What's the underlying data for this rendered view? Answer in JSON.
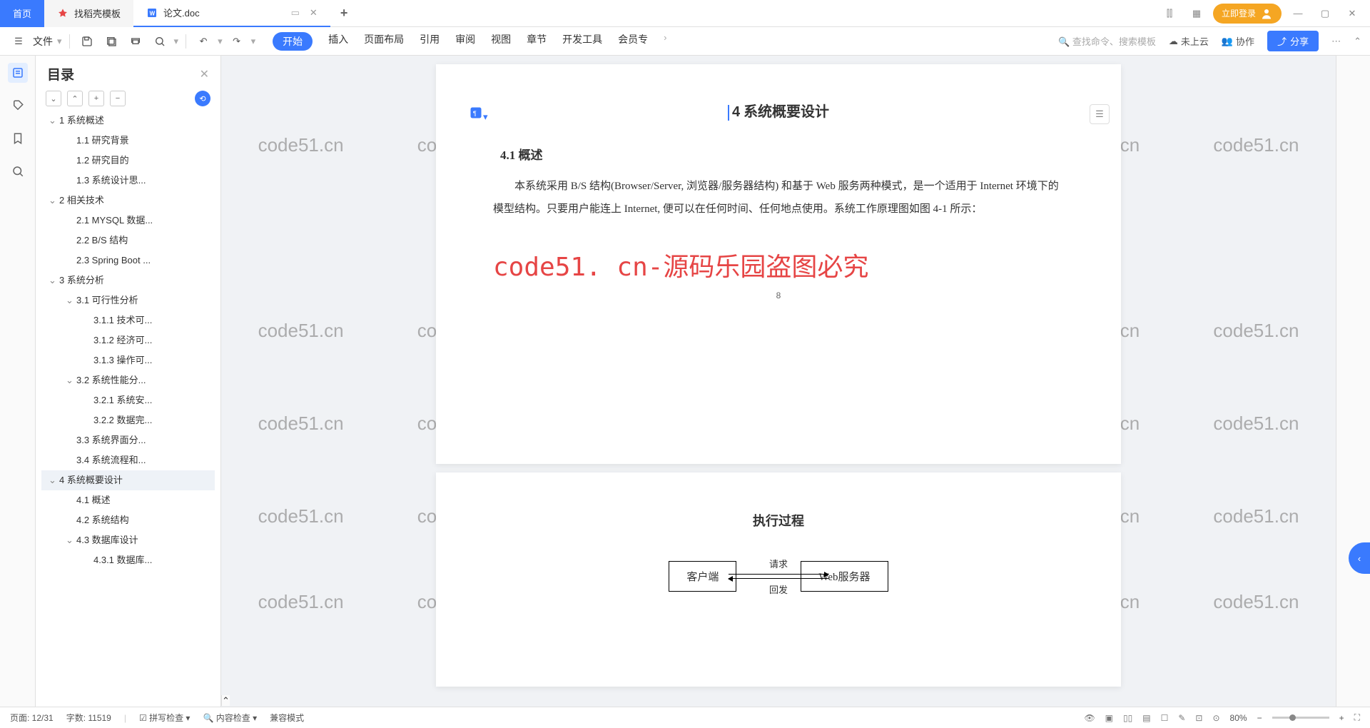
{
  "tabs": {
    "home": "首页",
    "template": "找稻壳模板",
    "doc": "论文.doc"
  },
  "titlebar": {
    "login": "立即登录"
  },
  "ribbon": {
    "file": "文件",
    "tabs": [
      "开始",
      "插入",
      "页面布局",
      "引用",
      "审阅",
      "视图",
      "章节",
      "开发工具",
      "会员专"
    ],
    "search": "查找命令、搜索模板",
    "cloud": "未上云",
    "collab": "协作",
    "share": "分享"
  },
  "outline": {
    "title": "目录",
    "items": [
      {
        "t": "1 系统概述",
        "lv": 1,
        "c": true
      },
      {
        "t": "1.1 研究背景",
        "lv": 2
      },
      {
        "t": "1.2 研究目的",
        "lv": 2
      },
      {
        "t": "1.3 系统设计思...",
        "lv": 2
      },
      {
        "t": "2 相关技术",
        "lv": 1,
        "c": true
      },
      {
        "t": "2.1 MYSQL 数据...",
        "lv": 2
      },
      {
        "t": "2.2 B/S 结构",
        "lv": 2
      },
      {
        "t": "2.3 Spring Boot ...",
        "lv": 2
      },
      {
        "t": "3 系统分析",
        "lv": 1,
        "c": true
      },
      {
        "t": "3.1 可行性分析",
        "lv": 2,
        "c": true
      },
      {
        "t": "3.1.1 技术可...",
        "lv": 3
      },
      {
        "t": "3.1.2 经济可...",
        "lv": 3
      },
      {
        "t": "3.1.3 操作可...",
        "lv": 3
      },
      {
        "t": "3.2 系统性能分...",
        "lv": 2,
        "c": true
      },
      {
        "t": "3.2.1 系统安...",
        "lv": 3
      },
      {
        "t": "3.2.2 数据完...",
        "lv": 3
      },
      {
        "t": "3.3 系统界面分...",
        "lv": 2
      },
      {
        "t": "3.4 系统流程和...",
        "lv": 2
      },
      {
        "t": "4 系统概要设计",
        "lv": 1,
        "c": true,
        "cur": true
      },
      {
        "t": "4.1 概述",
        "lv": 2
      },
      {
        "t": "4.2 系统结构",
        "lv": 2
      },
      {
        "t": "4.3 数据库设计",
        "lv": 2,
        "c": true
      },
      {
        "t": "4.3.1 数据库...",
        "lv": 3
      }
    ]
  },
  "doc": {
    "h1": "系统概要设计",
    "h1num": "4",
    "h2": "4.1 概述",
    "para": "本系统采用 B/S 结构(Browser/Server, 浏览器/服务器结构) 和基于 Web 服务两种模式，是一个适用于 Internet 环境下的模型结构。只要用户能连上 Internet, 便可以在任何时间、任何地点使用。系统工作原理图如图 4-1 所示：",
    "bigwm": "code51. cn-源码乐园盗图必究",
    "wm": "code51.cn",
    "pnum": "8",
    "p2h": "执行过程",
    "box1": "客户端",
    "box2": "Web服务器",
    "a1": "请求",
    "a2": "回发"
  },
  "status": {
    "page": "页面: 12/31",
    "words": "字数: 11519",
    "spell": "拼写检查",
    "content": "内容检查",
    "compat": "兼容模式",
    "zoom": "80%"
  }
}
